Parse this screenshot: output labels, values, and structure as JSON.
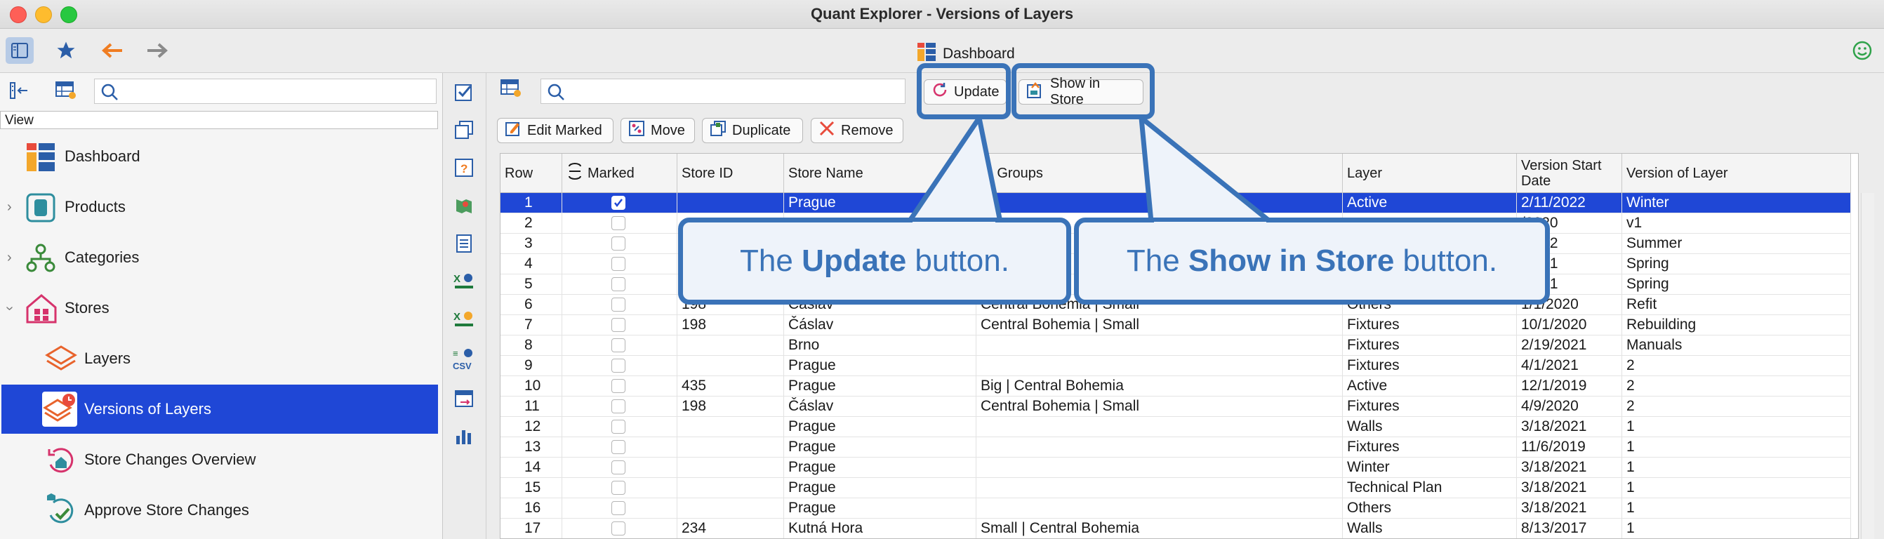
{
  "window": {
    "title": "Quant Explorer - Versions of Layers"
  },
  "toolbar": {
    "location_label": "Dashboard"
  },
  "sidebar": {
    "view_label": "View",
    "items": [
      {
        "label": "Dashboard"
      },
      {
        "label": "Products"
      },
      {
        "label": "Categories"
      },
      {
        "label": "Stores"
      },
      {
        "label": "Layers"
      },
      {
        "label": "Versions of Layers"
      },
      {
        "label": "Store Changes Overview"
      },
      {
        "label": "Approve Store Changes"
      }
    ]
  },
  "actions": {
    "update": "Update",
    "show_in_store": "Show in Store",
    "edit_marked": "Edit Marked",
    "move": "Move",
    "duplicate": "Duplicate",
    "remove": "Remove"
  },
  "table": {
    "headers": {
      "row": "Row",
      "marked": "Marked",
      "store_id": "Store ID",
      "store_name": "Store Name",
      "store_groups": "re Groups",
      "layer": "Layer",
      "version_start_1": "Version Start",
      "version_start_2": "Date",
      "version": "Version of Layer"
    },
    "rows": [
      {
        "row": "1",
        "store_id": "",
        "store_name": "Prague",
        "store_groups": "",
        "layer": "Active",
        "date": "2/11/2022",
        "version": "Winter"
      },
      {
        "row": "2",
        "store_id": "",
        "store_name": "",
        "store_groups": "",
        "layer": "",
        "date": "/2020",
        "version": "v1"
      },
      {
        "row": "3",
        "store_id": "",
        "store_name": "",
        "store_groups": "",
        "layer": "",
        "date": "/2022",
        "version": "Summer"
      },
      {
        "row": "4",
        "store_id": "",
        "store_name": "",
        "store_groups": "",
        "layer": "",
        "date": "/2021",
        "version": "Spring"
      },
      {
        "row": "5",
        "store_id": "",
        "store_name": "",
        "store_groups": "",
        "layer": "",
        "date": "/2021",
        "version": "Spring"
      },
      {
        "row": "6",
        "store_id": "198",
        "store_name": "Čáslav",
        "store_groups": "Central Bohemia | Small",
        "layer": "Others",
        "date": "1/1/2020",
        "version": "Refit"
      },
      {
        "row": "7",
        "store_id": "198",
        "store_name": "Čáslav",
        "store_groups": "Central Bohemia | Small",
        "layer": "Fixtures",
        "date": "10/1/2020",
        "version": "Rebuilding"
      },
      {
        "row": "8",
        "store_id": "",
        "store_name": "Brno",
        "store_groups": "",
        "layer": "Fixtures",
        "date": "2/19/2021",
        "version": "Manuals"
      },
      {
        "row": "9",
        "store_id": "",
        "store_name": "Prague",
        "store_groups": "",
        "layer": "Fixtures",
        "date": "4/1/2021",
        "version": "2"
      },
      {
        "row": "10",
        "store_id": "435",
        "store_name": "Prague",
        "store_groups": "Big | Central Bohemia",
        "layer": "Active",
        "date": "12/1/2019",
        "version": "2"
      },
      {
        "row": "11",
        "store_id": "198",
        "store_name": "Čáslav",
        "store_groups": "Central Bohemia | Small",
        "layer": "Fixtures",
        "date": "4/9/2020",
        "version": "2"
      },
      {
        "row": "12",
        "store_id": "",
        "store_name": "Prague",
        "store_groups": "",
        "layer": "Walls",
        "date": "3/18/2021",
        "version": "1"
      },
      {
        "row": "13",
        "store_id": "",
        "store_name": "Prague",
        "store_groups": "",
        "layer": "Fixtures",
        "date": "11/6/2019",
        "version": "1"
      },
      {
        "row": "14",
        "store_id": "",
        "store_name": "Prague",
        "store_groups": "",
        "layer": "Winter",
        "date": "3/18/2021",
        "version": "1"
      },
      {
        "row": "15",
        "store_id": "",
        "store_name": "Prague",
        "store_groups": "",
        "layer": "Technical Plan",
        "date": "3/18/2021",
        "version": "1"
      },
      {
        "row": "16",
        "store_id": "",
        "store_name": "Prague",
        "store_groups": "",
        "layer": "Others",
        "date": "3/18/2021",
        "version": "1"
      },
      {
        "row": "17",
        "store_id": "234",
        "store_name": "Kutná Hora",
        "store_groups": "Small | Central Bohemia",
        "layer": "Walls",
        "date": "8/13/2017",
        "version": "1"
      }
    ]
  },
  "callouts": {
    "update": {
      "pre": "The ",
      "bold": "Update",
      "post": " button."
    },
    "show_in_store": {
      "pre": "The ",
      "bold": "Show in Store",
      "post": " button."
    }
  },
  "colors": {
    "selection": "#1f47d6",
    "callout": "#3a73b8"
  }
}
